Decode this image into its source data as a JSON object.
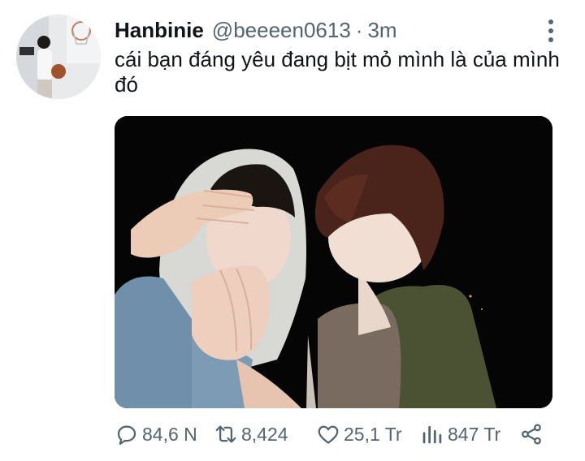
{
  "tweet": {
    "display_name": "Hanbinie",
    "handle": "@beeeen0613",
    "separator": "·",
    "time": "3m",
    "text": "cái bạn đáng yêu đang bịt mỏ mình là của mình đó"
  },
  "actions": {
    "replies": "84,6 N",
    "retweets": "8,424",
    "likes": "25,1 Tr",
    "views": "847 Tr"
  },
  "colors": {
    "text": "#0f1419",
    "secondary": "#536471",
    "photo_background": "#050505"
  }
}
